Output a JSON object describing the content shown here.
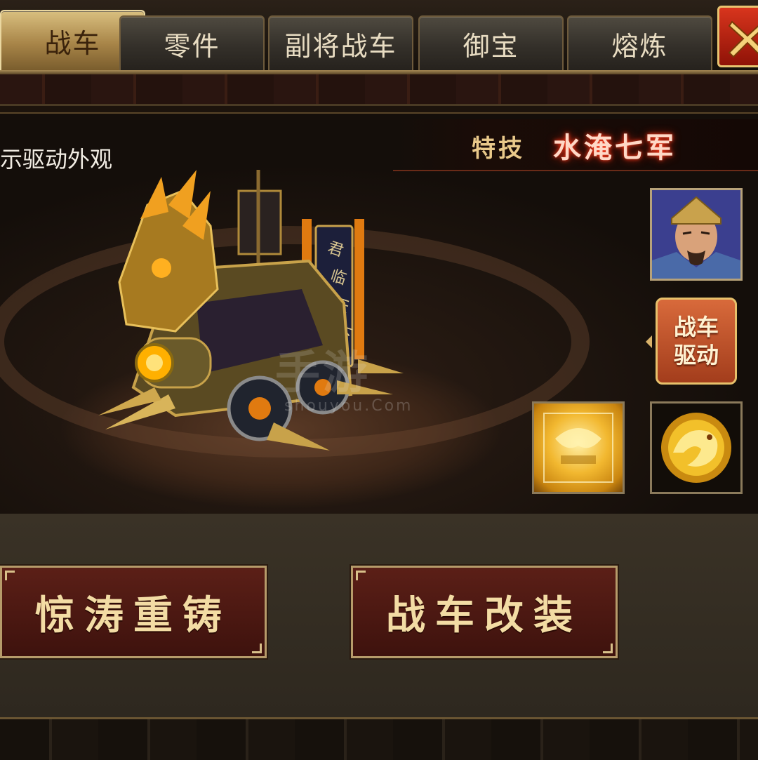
{
  "tabs": [
    {
      "label": "战车",
      "active": true
    },
    {
      "label": "零件",
      "active": false
    },
    {
      "label": "副将战车",
      "active": false
    },
    {
      "label": "御宝",
      "active": false
    },
    {
      "label": "熔炼",
      "active": false
    }
  ],
  "close_icon": "close-x-icon",
  "main": {
    "appearance_label": "示驱动外观",
    "skill": {
      "label": "特技",
      "name": "水淹七军"
    },
    "drive_button": {
      "line1": "战车",
      "line2": "驱动"
    },
    "watermark": {
      "main": "手游",
      "sub": "shouyou.Com"
    }
  },
  "actions": {
    "recast": "惊涛重铸",
    "modify": "战车改装"
  },
  "colors": {
    "accent_gold": "#e9c98a",
    "skill_glow": "#ff3a1a",
    "close_red": "#c8260f",
    "button_bg": "#4e1a13"
  }
}
